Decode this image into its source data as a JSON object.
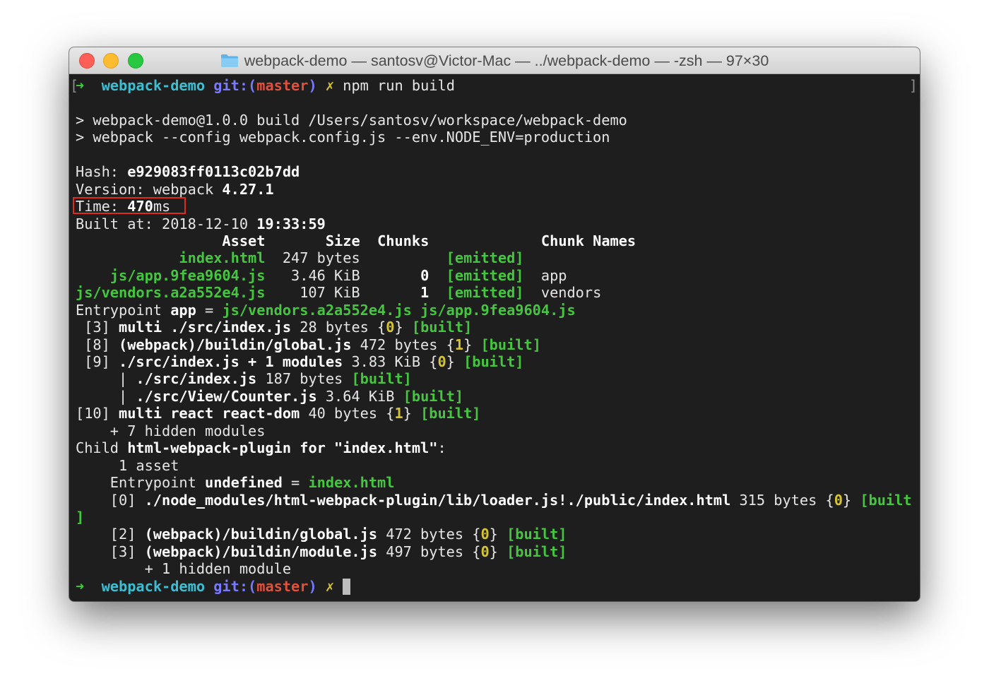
{
  "window": {
    "title": "webpack-demo — santosv@Victor-Mac — ../webpack-demo — -zsh — 97×30",
    "folder_icon": "folder-icon",
    "controls": [
      "close",
      "minimize",
      "zoom"
    ]
  },
  "terminal": {
    "bracket_left": "[",
    "bracket_right": "]",
    "colors": {
      "background": "#1e1e1e",
      "text": "#e6e6e6",
      "green": "#44c63f",
      "yellow": "#d4c432",
      "cyan": "#3cbfd2",
      "blue": "#7979ff",
      "red": "#e2503c",
      "highlight_box": "#e02a1c"
    },
    "lines": [
      [
        [
          "➜",
          "a"
        ],
        [
          "  ",
          "n"
        ],
        [
          "webpack-demo",
          "c"
        ],
        [
          " ",
          "n"
        ],
        [
          "git:(",
          "p"
        ],
        [
          "master",
          "r"
        ],
        [
          ")",
          "p"
        ],
        [
          " ",
          "n"
        ],
        [
          "✗",
          "y"
        ],
        [
          " npm run build",
          "n"
        ]
      ],
      [],
      [
        [
          "> webpack-demo@1.0.0 build /Users/santosv/workspace/webpack-demo",
          "n"
        ]
      ],
      [
        [
          "> webpack --config webpack.config.js --env.NODE_ENV=production",
          "n"
        ]
      ],
      [],
      [
        [
          "Hash: ",
          "n"
        ],
        [
          "e929083ff0113c02b7dd",
          "b"
        ]
      ],
      [
        [
          "Version: webpack ",
          "n"
        ],
        [
          "4.27.1",
          "b"
        ]
      ],
      [
        [
          "Time: ",
          "n"
        ],
        [
          "470",
          "b"
        ],
        [
          "ms",
          "n"
        ]
      ],
      [
        [
          "Built at: 2018-12-10 ",
          "n"
        ],
        [
          "19:33:59",
          "b"
        ]
      ],
      [
        [
          "                 ",
          "n"
        ],
        [
          "Asset",
          "b"
        ],
        [
          "       ",
          "n"
        ],
        [
          "Size",
          "b"
        ],
        [
          "  ",
          "n"
        ],
        [
          "Chunks",
          "b"
        ],
        [
          "             ",
          "n"
        ],
        [
          "Chunk Names",
          "b"
        ]
      ],
      [
        [
          "            ",
          "n"
        ],
        [
          "index.html",
          "g"
        ],
        [
          "  247 bytes          ",
          "n"
        ],
        [
          "[emitted]",
          "g"
        ]
      ],
      [
        [
          "    ",
          "n"
        ],
        [
          "js/app.9fea9604.js",
          "g"
        ],
        [
          "   3.46 KiB       ",
          "n"
        ],
        [
          "0",
          "b"
        ],
        [
          "  ",
          "n"
        ],
        [
          "[emitted]",
          "g"
        ],
        [
          "  app",
          "n"
        ]
      ],
      [
        [
          "js/vendors.a2a552e4.js",
          "g"
        ],
        [
          "    107 KiB       ",
          "n"
        ],
        [
          "1",
          "b"
        ],
        [
          "  ",
          "n"
        ],
        [
          "[emitted]",
          "g"
        ],
        [
          "  vendors",
          "n"
        ]
      ],
      [
        [
          "Entrypoint ",
          "n"
        ],
        [
          "app",
          "b"
        ],
        [
          " = ",
          "n"
        ],
        [
          "js/vendors.a2a552e4.js",
          "g"
        ],
        [
          " ",
          "n"
        ],
        [
          "js/app.9fea9604.js",
          "g"
        ]
      ],
      [
        [
          " [3] ",
          "n"
        ],
        [
          "multi ./src/index.js",
          "b"
        ],
        [
          " 28 bytes {",
          "n"
        ],
        [
          "0",
          "y"
        ],
        [
          "} ",
          "n"
        ],
        [
          "[built]",
          "g"
        ]
      ],
      [
        [
          " [8] ",
          "n"
        ],
        [
          "(webpack)/buildin/global.js",
          "b"
        ],
        [
          " 472 bytes {",
          "n"
        ],
        [
          "1",
          "y"
        ],
        [
          "} ",
          "n"
        ],
        [
          "[built]",
          "g"
        ]
      ],
      [
        [
          " [9] ",
          "n"
        ],
        [
          "./src/index.js + 1 modules",
          "b"
        ],
        [
          " 3.83 KiB {",
          "n"
        ],
        [
          "0",
          "y"
        ],
        [
          "} ",
          "n"
        ],
        [
          "[built]",
          "g"
        ]
      ],
      [
        [
          "     | ",
          "n"
        ],
        [
          "./src/index.js",
          "b"
        ],
        [
          " 187 bytes ",
          "n"
        ],
        [
          "[built]",
          "g"
        ]
      ],
      [
        [
          "     | ",
          "n"
        ],
        [
          "./src/View/Counter.js",
          "b"
        ],
        [
          " 3.64 KiB ",
          "n"
        ],
        [
          "[built]",
          "g"
        ]
      ],
      [
        [
          "[10] ",
          "n"
        ],
        [
          "multi react react-dom",
          "b"
        ],
        [
          " 40 bytes {",
          "n"
        ],
        [
          "1",
          "y"
        ],
        [
          "} ",
          "n"
        ],
        [
          "[built]",
          "g"
        ]
      ],
      [
        [
          "    + 7 hidden modules",
          "n"
        ]
      ],
      [
        [
          "Child ",
          "n"
        ],
        [
          "html-webpack-plugin for \"index.html\"",
          "b"
        ],
        [
          ":",
          "n"
        ]
      ],
      [
        [
          "     1 asset",
          "n"
        ]
      ],
      [
        [
          "    Entrypoint ",
          "n"
        ],
        [
          "undefined",
          "b"
        ],
        [
          " = ",
          "n"
        ],
        [
          "index.html",
          "g"
        ]
      ],
      [
        [
          "    [0] ",
          "n"
        ],
        [
          "./node_modules/html-webpack-plugin/lib/loader.js!./public/index.html",
          "b"
        ],
        [
          " 315 bytes {",
          "n"
        ],
        [
          "0",
          "y"
        ],
        [
          "} ",
          "n"
        ],
        [
          "[built",
          "g"
        ]
      ],
      [
        [
          "]",
          "g"
        ]
      ],
      [
        [
          "    [2] ",
          "n"
        ],
        [
          "(webpack)/buildin/global.js",
          "b"
        ],
        [
          " 472 bytes {",
          "n"
        ],
        [
          "0",
          "y"
        ],
        [
          "} ",
          "n"
        ],
        [
          "[built]",
          "g"
        ]
      ],
      [
        [
          "    [3] ",
          "n"
        ],
        [
          "(webpack)/buildin/module.js",
          "b"
        ],
        [
          " 497 bytes {",
          "n"
        ],
        [
          "0",
          "y"
        ],
        [
          "} ",
          "n"
        ],
        [
          "[built]",
          "g"
        ]
      ],
      [
        [
          "        + 1 hidden module",
          "n"
        ]
      ],
      [
        [
          "➜",
          "a"
        ],
        [
          "  ",
          "n"
        ],
        [
          "webpack-demo",
          "c"
        ],
        [
          " ",
          "n"
        ],
        [
          "git:(",
          "p"
        ],
        [
          "master",
          "r"
        ],
        [
          ")",
          "p"
        ],
        [
          " ",
          "n"
        ],
        [
          "✗",
          "y"
        ],
        [
          " ",
          "n"
        ]
      ]
    ],
    "cursor_line": 29,
    "highlighted_line": 7
  }
}
